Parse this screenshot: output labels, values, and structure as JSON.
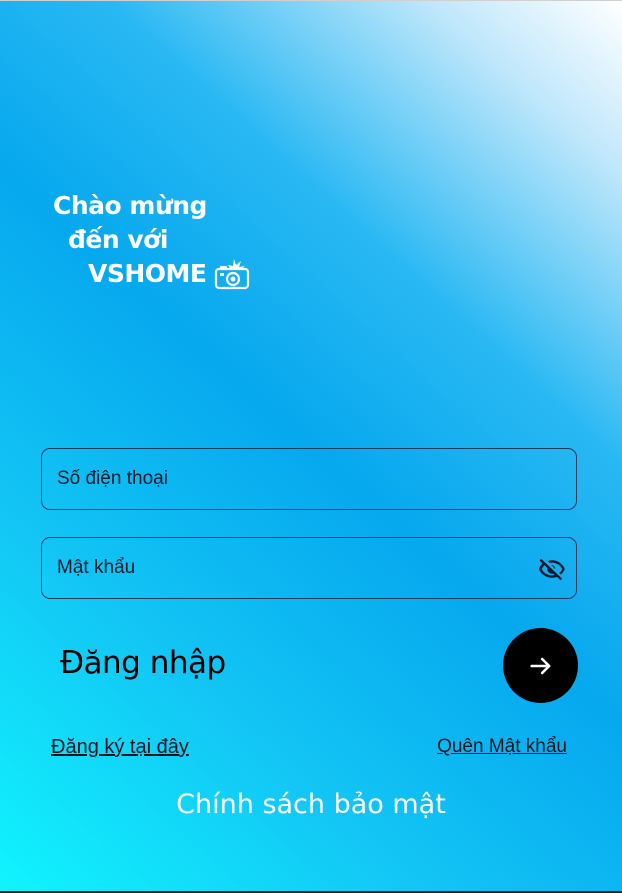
{
  "welcome": {
    "line1": "Chào mừng",
    "line2": "đến với",
    "line3": "VSHOME",
    "emoji_icon": "camera-with-flash-icon"
  },
  "form": {
    "phone_placeholder": "Số điện thoại",
    "password_placeholder": "Mật khẩu",
    "password_toggle_icon": "eye-off-icon"
  },
  "login": {
    "label": "Đăng nhập",
    "submit_icon": "arrow-right-icon"
  },
  "links": {
    "register": "Đăng ký tại đây",
    "forgot_password": "Quên Mật khẩu",
    "privacy_policy": "Chính sách bảo mật"
  },
  "colors": {
    "gradient_top_right": "#ffffff",
    "gradient_mid": "#06a8ee",
    "gradient_bottom_left": "#10f4fe",
    "button": "#000000",
    "text_light": "#ffffff"
  }
}
